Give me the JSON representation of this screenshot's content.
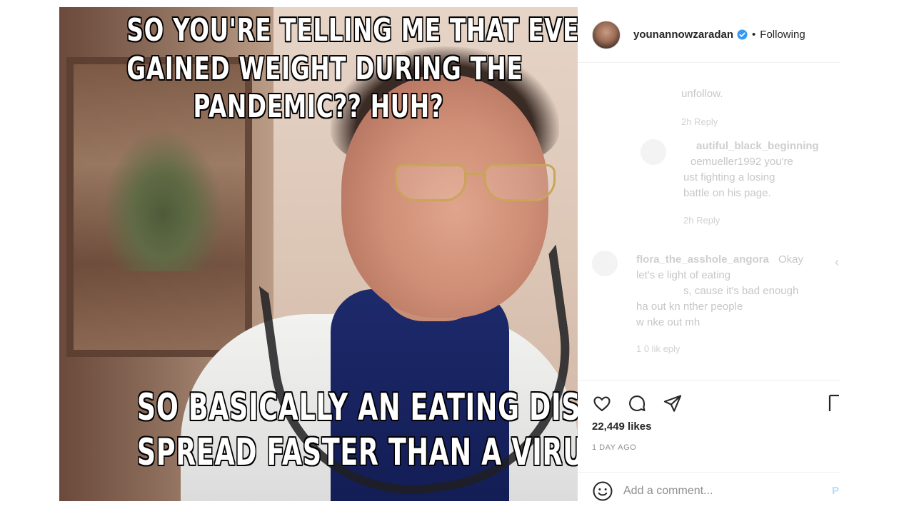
{
  "meme": {
    "top_lines": [
      "SO YOU'RE TELLING ME THAT EVERYONE",
      "GAINED WEIGHT DURING THE",
      "PANDEMIC?? HUH?"
    ],
    "bottom_lines": [
      "SO BASICALLY AN EATING DISORDER",
      "SPREAD FASTER THAN A VIRUS!?"
    ]
  },
  "post": {
    "username": "younannowzaradan",
    "dot": "•",
    "follow_status": "Following",
    "likes": "22,449 likes",
    "time": "1 DAY AGO",
    "comment_placeholder": "Add a comment...",
    "post_label": "P"
  },
  "comments_faded": {
    "c1_tail": "unfollow.",
    "c1_meta": "2h   Reply",
    "c2_user": "autiful_black_beginning",
    "c2_line1": "oemueller1992 you're",
    "c2_line2": "ust fighting a losing",
    "c2_line3": "battle on his page.",
    "c2_meta": "2h   Reply",
    "c3_user": "flora_the_asshole_angora",
    "c3_text1": "Okay",
    "c3_line2": "let's    e light of eating",
    "c3_line3": "s, cause it's bad enough",
    "c3_line4": "ha     out kn        nther people",
    "c3_line5": "w        nke   out     mh",
    "c3_meta": "1      0 lik      eply"
  },
  "colors": {
    "accent_blue": "#3897f0",
    "text": "#262626",
    "muted": "#8e8e8e"
  },
  "icons": [
    "verified-badge-icon",
    "heart-icon",
    "comment-icon",
    "share-icon",
    "bookmark-icon",
    "emoji-icon"
  ]
}
